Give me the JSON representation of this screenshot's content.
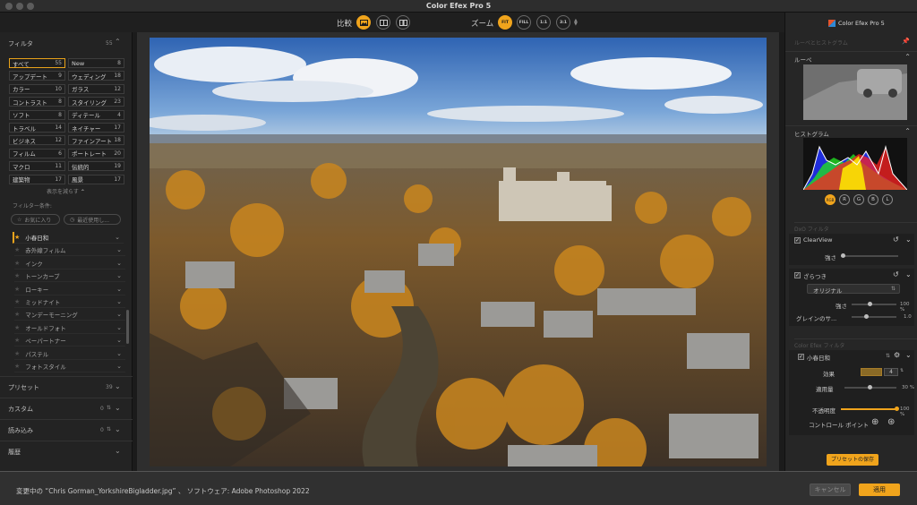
{
  "window": {
    "title": "Color Efex Pro 5"
  },
  "toolbar": {
    "compare_label": "比較",
    "zoom_label": "ズーム",
    "zoom_buttons": [
      "FIT",
      "FILL",
      "1:1",
      "3:1"
    ]
  },
  "left": {
    "filters_title": "フィルタ",
    "filters_count": "55",
    "categories": [
      {
        "label": "すべて",
        "count": "55"
      },
      {
        "label": "New",
        "count": "8"
      },
      {
        "label": "アップデート",
        "count": "9"
      },
      {
        "label": "ウェディング",
        "count": "18"
      },
      {
        "label": "カラー",
        "count": "10"
      },
      {
        "label": "ガラス",
        "count": "12"
      },
      {
        "label": "コントラスト",
        "count": "8"
      },
      {
        "label": "スタイリング",
        "count": "23"
      },
      {
        "label": "ソフト",
        "count": "8"
      },
      {
        "label": "ディテール",
        "count": "4"
      },
      {
        "label": "トラベル",
        "count": "14"
      },
      {
        "label": "ネイチャー",
        "count": "17"
      },
      {
        "label": "ビジネス",
        "count": "12"
      },
      {
        "label": "ファインアート",
        "count": "18"
      },
      {
        "label": "フィルム",
        "count": "6"
      },
      {
        "label": "ポートレート",
        "count": "20"
      },
      {
        "label": "マクロ",
        "count": "11"
      },
      {
        "label": "伝統的",
        "count": "19"
      },
      {
        "label": "建築物",
        "count": "17"
      },
      {
        "label": "風景",
        "count": "17"
      }
    ],
    "show_less": "表示を減らす",
    "filter_conditions": "フィルター条件:",
    "pill_favorites": "お気に入り",
    "pill_recent": "最近使用し...",
    "filter_list": [
      "小春日和",
      "赤外線フィルム",
      "インク",
      "トーンカーブ",
      "ローキー",
      "ミッドナイト",
      "マンデーモーニング",
      "オールドフォト",
      "ペーパートナー",
      "パステル",
      "フォトスタイル"
    ],
    "presets_label": "プリセット",
    "presets_count": "39",
    "custom_label": "カスタム",
    "custom_count": "0",
    "imported_label": "読み込み",
    "imported_count": "0",
    "history_label": "履歴"
  },
  "right": {
    "brand": "Color Efex Pro 5",
    "loupe_hist_title": "ルーペとヒストグラム",
    "loupe_label": "ルーペ",
    "histogram_label": "ヒストグラム",
    "channel_buttons": [
      "RGB",
      "R",
      "G",
      "B",
      "L"
    ],
    "dxo_filters_label": "DxO フィルタ",
    "clearview_label": "ClearView",
    "strength_label": "強さ",
    "grain_label": "ざらつき",
    "grain_select": "オリジナル",
    "grain_strength_label": "強さ",
    "grain_strength_value": "100 %",
    "grain_size_label": "グレインのサ...",
    "grain_size_value": "1.0",
    "cep_filters_label": "Color Efex フィルタ",
    "filter_name": "小春日和",
    "effect_label": "効果",
    "effect_value": "4",
    "apply_amount_label": "適用量",
    "apply_amount_value": "30 %",
    "opacity_label": "不透明度",
    "opacity_value": "100 %",
    "control_points_label": "コントロール ポイント",
    "save_preset": "プリセットの保存"
  },
  "bottom": {
    "status": "変更中の “Chris Gorman_YorkshireBigladder.jpg” 、 ソフトウェア: Adobe Photoshop 2022",
    "cancel": "キャンセル",
    "apply": "適用"
  },
  "colors": {
    "accent": "#f0a41c"
  }
}
